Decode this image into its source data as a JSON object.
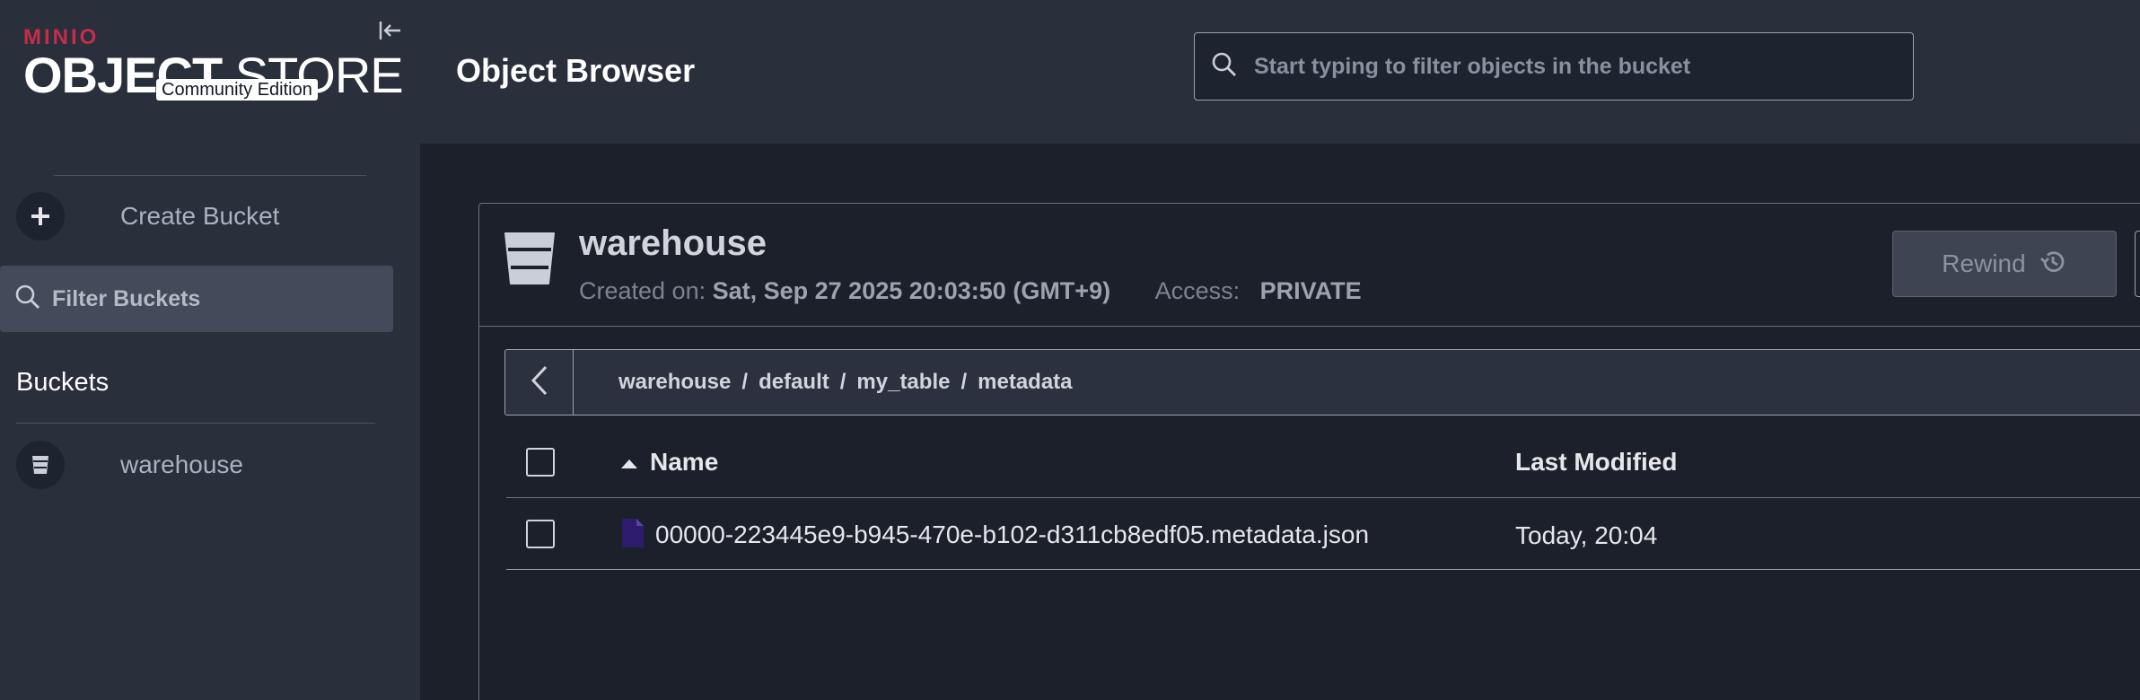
{
  "sidebar": {
    "logo": {
      "brand": "MINIO",
      "title_bold": "OBJECT",
      "title_light": "STORE",
      "edition": "Community Edition"
    },
    "create_bucket_label": "Create Bucket",
    "filter_placeholder": "Filter Buckets",
    "buckets_heading": "Buckets",
    "buckets": [
      {
        "label": "warehouse"
      }
    ]
  },
  "header": {
    "title": "Object Browser",
    "search_placeholder": "Start typing to filter objects in the bucket"
  },
  "bucket": {
    "name": "warehouse",
    "created_label": "Created on:",
    "created_value": "Sat, Sep 27 2025 20:03:50 (GMT+9)",
    "access_label": "Access:",
    "access_value": "PRIVATE",
    "rewind_label": "Rewind"
  },
  "breadcrumb": [
    "warehouse",
    "default",
    "my_table",
    "metadata"
  ],
  "table": {
    "columns": {
      "name": "Name",
      "last_modified": "Last Modified"
    },
    "sort": {
      "column": "Name",
      "direction": "ascending"
    },
    "rows": [
      {
        "name": "00000-223445e9-b945-470e-b102-d311cb8edf05.metadata.json",
        "last_modified": "Today, 20:04"
      }
    ]
  },
  "colors": {
    "brand": "#c72c48",
    "sidebar_bg": "#2a2f3c",
    "page_bg": "#1c202a",
    "file_icon": "#2d1b6e"
  }
}
